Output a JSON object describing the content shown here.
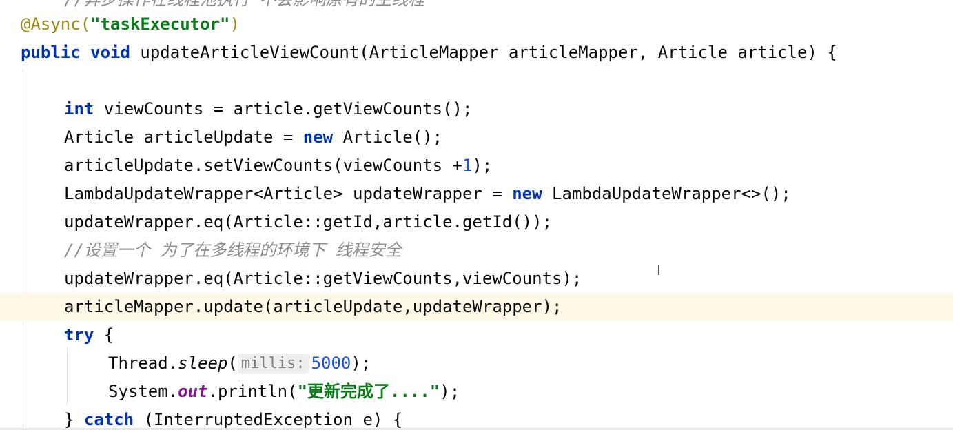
{
  "editor": {
    "lines": [
      {
        "id": "comment-top",
        "tokens": [
          {
            "t": "//异步操作在线程池执行 不会影响原有的主线程",
            "c": "cmt"
          }
        ]
      },
      {
        "id": "annotation",
        "tokens": [
          {
            "t": "@Async(",
            "c": "ann"
          },
          {
            "t": "\"taskExecutor\"",
            "c": "str"
          },
          {
            "t": ")",
            "c": "ann"
          }
        ]
      },
      {
        "id": "method-signature",
        "tokens": [
          {
            "t": "public",
            "c": "kw"
          },
          {
            "t": " "
          },
          {
            "t": "void",
            "c": "kw"
          },
          {
            "t": " updateArticleViewCount(ArticleMapper articleMapper, Article article) {"
          }
        ]
      },
      {
        "id": "blank",
        "tokens": []
      },
      {
        "id": "view-counts",
        "tokens": [
          {
            "t": "int",
            "c": "kw"
          },
          {
            "t": " viewCounts = article.getViewCounts();"
          }
        ]
      },
      {
        "id": "new-article",
        "tokens": [
          {
            "t": "Article articleUpdate = "
          },
          {
            "t": "new",
            "c": "kw"
          },
          {
            "t": " Article();"
          }
        ]
      },
      {
        "id": "set-view-counts",
        "tokens": [
          {
            "t": "articleUpdate.setViewCounts(viewCounts +"
          },
          {
            "t": "1",
            "c": "num"
          },
          {
            "t": ");"
          }
        ]
      },
      {
        "id": "wrapper-decl",
        "tokens": [
          {
            "t": "LambdaUpdateWrapper<Article> updateWrapper = "
          },
          {
            "t": "new",
            "c": "kw"
          },
          {
            "t": " LambdaUpdateWrapper<>();"
          }
        ]
      },
      {
        "id": "eq-id",
        "tokens": [
          {
            "t": "updateWrapper.eq(Article::getId,article.getId());"
          }
        ]
      },
      {
        "id": "comment-safety",
        "tokens": [
          {
            "t": "//设置一个 为了在多线程的环境下 线程安全",
            "c": "cmt"
          }
        ]
      },
      {
        "id": "eq-view-counts",
        "tokens": [
          {
            "t": "updateWrapper.eq(Article::getViewCounts,viewCounts);"
          }
        ]
      },
      {
        "id": "mapper-update",
        "tokens": [
          {
            "t": "articleMapper.update(articleUpdate,updateWrapper);"
          }
        ]
      },
      {
        "id": "try-open",
        "tokens": [
          {
            "t": "try",
            "c": "kw"
          },
          {
            "t": " {"
          }
        ]
      },
      {
        "id": "thread-sleep",
        "tokens": [
          {
            "t": "Thread."
          },
          {
            "t": "sleep",
            "c": "static-call"
          },
          {
            "t": "("
          },
          {
            "t": "millis:",
            "c": "hint"
          },
          {
            "t": "5000",
            "c": "num"
          },
          {
            "t": ");"
          }
        ]
      },
      {
        "id": "println",
        "tokens": [
          {
            "t": "System."
          },
          {
            "t": "out",
            "c": "static-field"
          },
          {
            "t": ".println("
          },
          {
            "t": "\"更新完成了....\"",
            "c": "str"
          },
          {
            "t": ");"
          }
        ]
      },
      {
        "id": "catch",
        "tokens": [
          {
            "t": "} "
          },
          {
            "t": "catch",
            "c": "kw"
          },
          {
            "t": " (InterruptedException e) {"
          }
        ]
      }
    ]
  }
}
